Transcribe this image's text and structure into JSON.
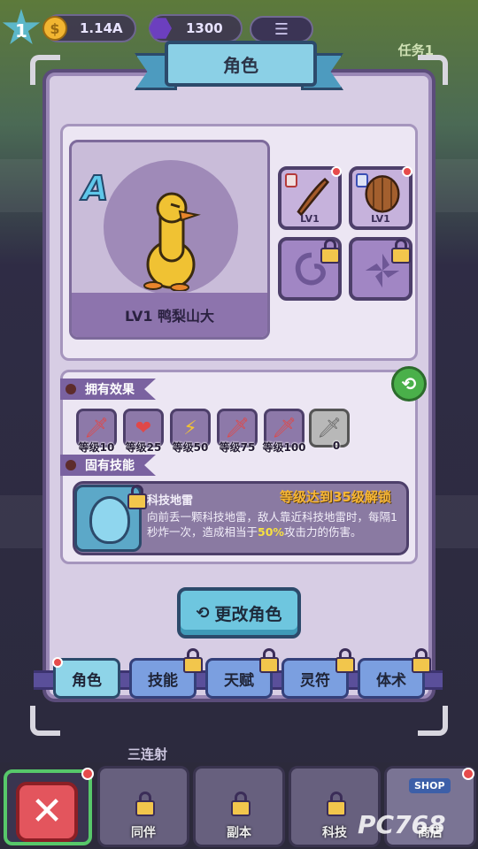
{
  "topbar": {
    "level": "1",
    "coins": "1.14A",
    "gems": "1300",
    "task_label": "任务1"
  },
  "dialog": {
    "title": "角色",
    "character": {
      "grade": "A",
      "name": "LV1  鸭梨山大"
    },
    "equipment": [
      {
        "name": "weapon",
        "level": "LV1",
        "locked": false,
        "badge": true
      },
      {
        "name": "shield",
        "level": "LV1",
        "locked": false,
        "badge": true
      },
      {
        "name": "ring",
        "level": "",
        "locked": true,
        "badge": false
      },
      {
        "name": "shuriken",
        "level": "",
        "locked": true,
        "badge": false
      }
    ],
    "owned_effects_label": "拥有效果",
    "effects": [
      {
        "label": "等级10",
        "icon": "sword-icon"
      },
      {
        "label": "等级25",
        "icon": "heart-icon"
      },
      {
        "label": "等级50",
        "icon": "lightning-icon"
      },
      {
        "label": "等级75",
        "icon": "sword-icon"
      },
      {
        "label": "等级100",
        "icon": "sword-icon"
      },
      {
        "label": "0",
        "icon": "sword-icon"
      }
    ],
    "innate_skill_label": "固有技能",
    "skill": {
      "name": "科技地雷",
      "unlock": "等级达到35级解锁",
      "desc_part1": "向前丢一颗科技地雷，敌人靠近科技地雷时，每隔1秒炸一次，造成相当于",
      "desc_highlight": "50%",
      "desc_part2": "攻击力的伤害。"
    },
    "change_button": "更改角色",
    "tabs": [
      {
        "label": "角色",
        "locked": false,
        "active": true
      },
      {
        "label": "技能",
        "locked": true,
        "active": false
      },
      {
        "label": "天赋",
        "locked": true,
        "active": false
      },
      {
        "label": "灵符",
        "locked": true,
        "active": false
      },
      {
        "label": "体术",
        "locked": true,
        "active": false
      }
    ]
  },
  "bottom_nav": {
    "under_text": "三连射",
    "items": [
      {
        "label": "同伴"
      },
      {
        "label": "副本"
      },
      {
        "label": "科技"
      },
      {
        "label": "商店"
      }
    ],
    "shop_badge": "SHOP"
  },
  "watermark": "PC768",
  "colors": {
    "dialog_bg": "#d7cde4",
    "accent_blue": "#8bd0e6",
    "highlight_yellow": "#f7e040",
    "unlock_orange": "#f7b634",
    "close_red": "#e3555d"
  }
}
